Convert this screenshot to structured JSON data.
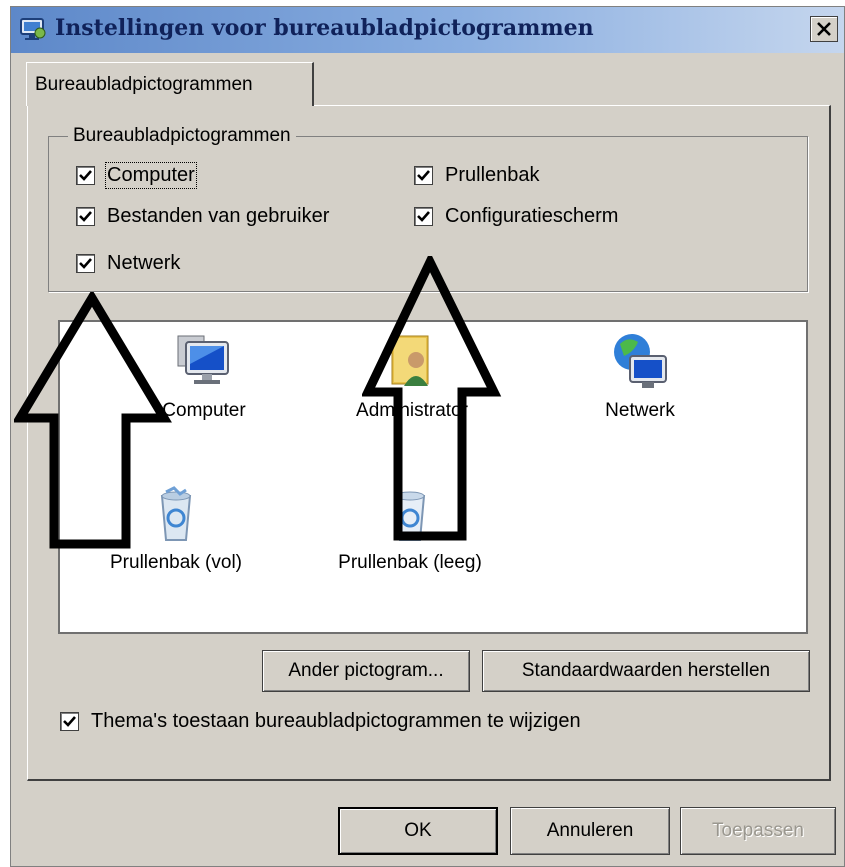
{
  "window": {
    "title": "Instellingen voor bureaubladpictogrammen",
    "close_glyph": "×"
  },
  "tab": {
    "label": "Bureaubladpictogrammen"
  },
  "group": {
    "legend": "Bureaubladpictogrammen",
    "checkboxes": [
      {
        "label": "Computer",
        "checked": true
      },
      {
        "label": "Prullenbak",
        "checked": true
      },
      {
        "label": "Bestanden van gebruiker",
        "checked": true
      },
      {
        "label": "Configuratiescherm",
        "checked": true
      },
      {
        "label": "Netwerk",
        "checked": true
      }
    ]
  },
  "icons": [
    {
      "label": "Computer",
      "icon": "computer-icon"
    },
    {
      "label": "Administrator",
      "icon": "user-folder-icon"
    },
    {
      "label": "Netwerk",
      "icon": "network-icon"
    },
    {
      "label": "Prullenbak (vol)",
      "icon": "recycle-bin-full-icon"
    },
    {
      "label": "Prullenbak (leeg)",
      "icon": "recycle-bin-empty-icon"
    }
  ],
  "buttons": {
    "change_icon": "Ander pictogram...",
    "restore_defaults": "Standaardwaarden herstellen",
    "ok": "OK",
    "cancel": "Annuleren",
    "apply": "Toepassen"
  },
  "allow_themes": {
    "label": "Thema's toestaan bureaubladpictogrammen te wijzigen",
    "checked": true
  },
  "colors": {
    "title_gradient_start": "#5d88c9",
    "dialog_bg": "#d4d0c8",
    "arrow": "#000000"
  }
}
